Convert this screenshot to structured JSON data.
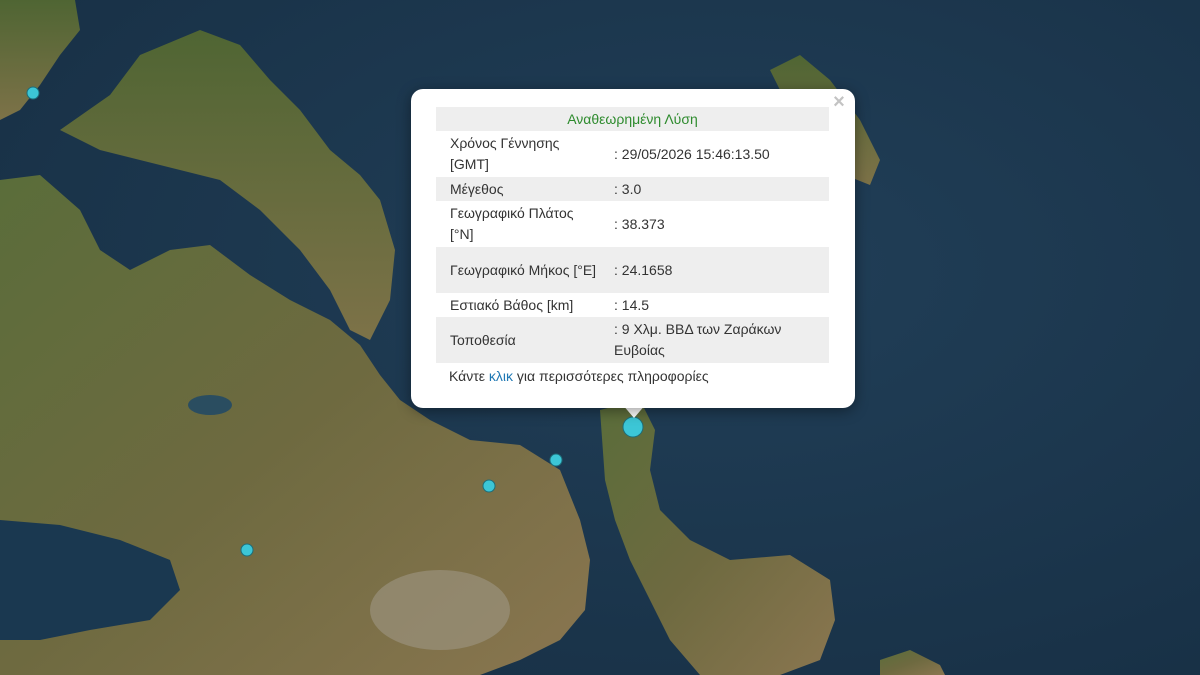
{
  "popup": {
    "title": "Αναθεωρημένη Λύση",
    "rows": [
      {
        "label": "Χρόνος Γέννησης [GMT]",
        "value": ": 29/05/2026 15:46:13.50"
      },
      {
        "label": "Μέγεθος",
        "value": ": 3.0"
      },
      {
        "label": "Γεωγραφικό Πλάτος [°N]",
        "value": ": 38.373"
      },
      {
        "label": "Γεωγραφικό Μήκος [°E]",
        "value": ": 24.1658"
      },
      {
        "label": "Εστιακό Βάθος [km]",
        "value": ": 14.5"
      },
      {
        "label": "Τοποθεσία",
        "value": ": 9 Χλμ. ΒΒΔ των Ζαράκων Ευβοίας"
      }
    ],
    "footer_before": "Κάντε ",
    "footer_link": "κλικ",
    "footer_after": " για περισσότερες πληροφορίες",
    "close_symbol": "×"
  },
  "colors": {
    "sea": "#1d3a52",
    "land": "#5e6b3e",
    "marker": "#3cc6d6",
    "title": "#2e8b2e",
    "link": "#1f78b4"
  },
  "icons": {
    "close": "close-icon",
    "marker": "earthquake-marker-icon"
  }
}
